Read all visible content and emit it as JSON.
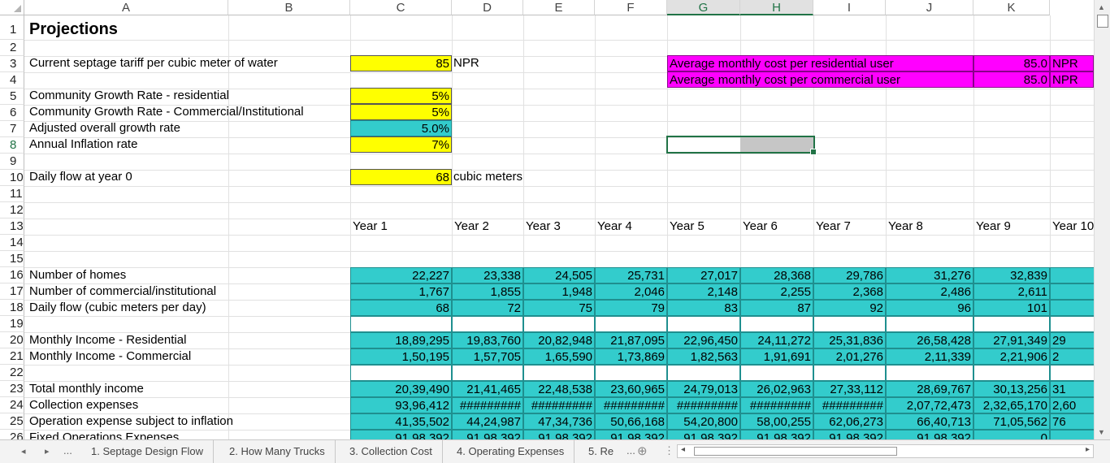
{
  "columns": [
    "A",
    "B",
    "C",
    "D",
    "E",
    "F",
    "G",
    "H",
    "I",
    "J",
    "K"
  ],
  "rows": [
    "1",
    "2",
    "3",
    "4",
    "5",
    "6",
    "7",
    "8",
    "9",
    "10",
    "11",
    "12",
    "13",
    "14",
    "15",
    "16",
    "17",
    "18",
    "19",
    "20",
    "21",
    "22",
    "23",
    "24",
    "25",
    "26"
  ],
  "title": "Projections",
  "inputs": {
    "tariff_label": "Current septage tariff per cubic meter of water",
    "tariff_value": "85",
    "tariff_unit": "NPR",
    "growth_res_label": "Community Growth Rate - residential",
    "growth_res_value": "5%",
    "growth_com_label": "Community Growth Rate - Commercial/Institutional",
    "growth_com_value": "5%",
    "adjusted_label": "Adjusted overall growth rate",
    "adjusted_value": "5.0%",
    "inflation_label": "Annual Inflation rate",
    "inflation_value": "7%",
    "flow_label": "Daily flow at year 0",
    "flow_value": "68",
    "flow_unit": "cubic meters"
  },
  "cost_box": {
    "res_label": "Average monthly cost per residential user",
    "res_value": "85.0",
    "com_label": "Average monthly cost per commercial user",
    "com_value": "85.0",
    "unit": "NPR"
  },
  "years": [
    "Year 1",
    "Year 2",
    "Year 3",
    "Year 4",
    "Year 5",
    "Year 6",
    "Year 7",
    "Year 8",
    "Year 9",
    "Year 10"
  ],
  "table_rows": [
    {
      "label": "Number of homes",
      "values": [
        "22,227",
        "23,338",
        "24,505",
        "25,731",
        "27,017",
        "28,368",
        "29,786",
        "31,276",
        "32,839",
        ""
      ]
    },
    {
      "label": "Number of commercial/institutional",
      "values": [
        "1,767",
        "1,855",
        "1,948",
        "2,046",
        "2,148",
        "2,255",
        "2,368",
        "2,486",
        "2,611",
        ""
      ]
    },
    {
      "label": "Daily flow (cubic meters per day)",
      "values": [
        "68",
        "72",
        "75",
        "79",
        "83",
        "87",
        "92",
        "96",
        "101",
        ""
      ]
    },
    {
      "label": "",
      "values": [
        "",
        "",
        "",
        "",
        "",
        "",
        "",
        "",
        "",
        ""
      ]
    },
    {
      "label": "Monthly Income - Residential",
      "values": [
        "18,89,295",
        "19,83,760",
        "20,82,948",
        "21,87,095",
        "22,96,450",
        "24,11,272",
        "25,31,836",
        "26,58,428",
        "27,91,349",
        "29"
      ]
    },
    {
      "label": "Monthly Income - Commercial",
      "values": [
        "1,50,195",
        "1,57,705",
        "1,65,590",
        "1,73,869",
        "1,82,563",
        "1,91,691",
        "2,01,276",
        "2,11,339",
        "2,21,906",
        "2"
      ]
    },
    {
      "label": "",
      "values": [
        "",
        "",
        "",
        "",
        "",
        "",
        "",
        "",
        "",
        ""
      ]
    },
    {
      "label": "Total monthly income",
      "values": [
        "20,39,490",
        "21,41,465",
        "22,48,538",
        "23,60,965",
        "24,79,013",
        "26,02,963",
        "27,33,112",
        "28,69,767",
        "30,13,256",
        "31"
      ]
    },
    {
      "label": "Collection expenses",
      "values": [
        "93,96,412",
        "#########",
        "#########",
        "#########",
        "#########",
        "#########",
        "#########",
        "2,07,72,473",
        "2,32,65,170",
        "2,60"
      ]
    },
    {
      "label": "Operation expense subject to inflation",
      "values": [
        "41,35,502",
        "44,24,987",
        "47,34,736",
        "50,66,168",
        "54,20,800",
        "58,00,255",
        "62,06,273",
        "66,40,713",
        "71,05,562",
        "76"
      ]
    },
    {
      "label": "Fixed Operations Expenses",
      "values": [
        "91,98,392",
        "91,98,392",
        "91,98,392",
        "91,98,392",
        "91,98,392",
        "91,98,392",
        "91,98,392",
        "91,98,392",
        "0",
        ""
      ]
    }
  ],
  "tabs": [
    "1. Septage Design Flow",
    "2. How Many Trucks",
    "3. Collection Cost",
    "4. Operating Expenses",
    "5. Re"
  ],
  "tab_nav": {
    "prev": "◂",
    "next": "▸",
    "more": "...",
    "more_right": "...",
    "add": "⊕",
    "dots": "⋮"
  }
}
